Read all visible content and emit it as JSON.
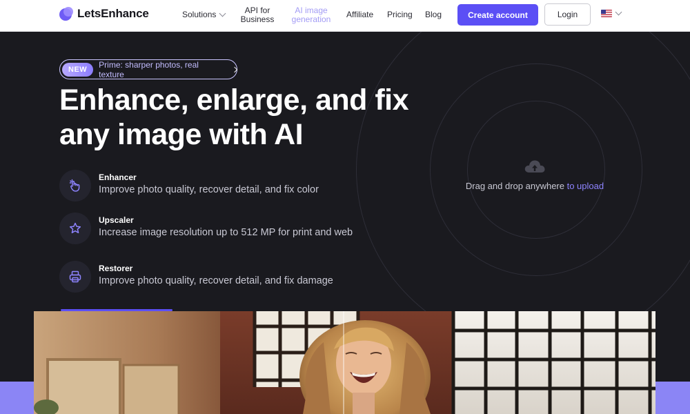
{
  "header": {
    "logo_text": "LetsEnhance",
    "nav": {
      "solutions": "Solutions",
      "api_line1": "API for",
      "api_line2": "Business",
      "ai_line1": "AI image",
      "ai_line2": "generation",
      "affiliate": "Affiliate",
      "pricing": "Pricing",
      "blog": "Blog"
    },
    "create_account": "Create account",
    "login": "Login",
    "language_icon": "us-flag-icon"
  },
  "hero": {
    "badge_new": "NEW",
    "badge_text": "Prime: sharper photos, real texture",
    "title_line1": "Enhance, enlarge, and fix",
    "title_line2": "any image with AI",
    "features": [
      {
        "name": "Enhancer",
        "desc": "Improve photo quality, recover detail, and fix color",
        "icon": "magic-hand-icon"
      },
      {
        "name": "Upscaler",
        "desc": "Increase image resolution up to 512 MP for print and web",
        "icon": "sparkle-star-icon"
      },
      {
        "name": "Restorer",
        "desc": "Improve photo quality, recover detail, and fix damage",
        "icon": "restore-printer-icon"
      }
    ],
    "upload_text": "Drag and drop anywhere ",
    "upload_link": "to upload",
    "upload_icon": "cloud-upload-icon"
  },
  "colors": {
    "accent": "#5b4ff5",
    "background": "#1a1a1f",
    "band": "#8b85f5"
  }
}
